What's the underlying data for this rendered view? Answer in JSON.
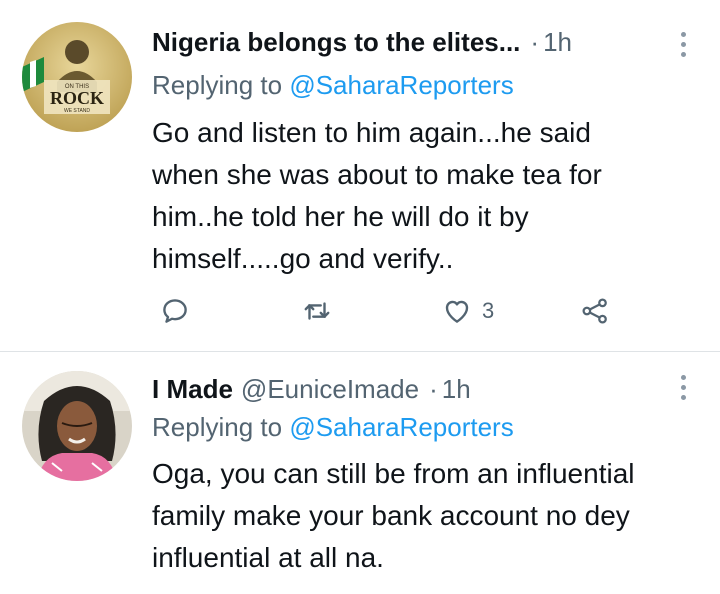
{
  "tweets": [
    {
      "name": "Nigeria belongs to the elites...",
      "handle": "",
      "time": "1h",
      "replying_prefix": "Replying to",
      "replying_to": "@SaharaReporters",
      "avatar_text_top": "ON THIS",
      "avatar_text_main": "ROCK",
      "avatar_text_bottom": "WE STAND",
      "lines": [
        "Go and listen to him again...he said",
        "when she was about to make tea for",
        "him..he told her he will do it by",
        "himself.....go and verify.."
      ],
      "actions": {
        "reply_icon": "reply-icon",
        "retweet_icon": "retweet-icon",
        "like_icon": "heart-icon",
        "like_count": "3",
        "share_icon": "share-icon"
      }
    },
    {
      "name": "I Made",
      "handle": "@EuniceImade",
      "time": "1h",
      "replying_prefix": "Replying to",
      "replying_to": "@SaharaReporters",
      "lines": [
        "Oga, you can still be from an influential",
        "family make your bank account no dey",
        "influential at all na."
      ]
    }
  ],
  "colors": {
    "link": "#1d9bf0",
    "secondary_text": "#536471",
    "divider": "#dfe3e6"
  }
}
